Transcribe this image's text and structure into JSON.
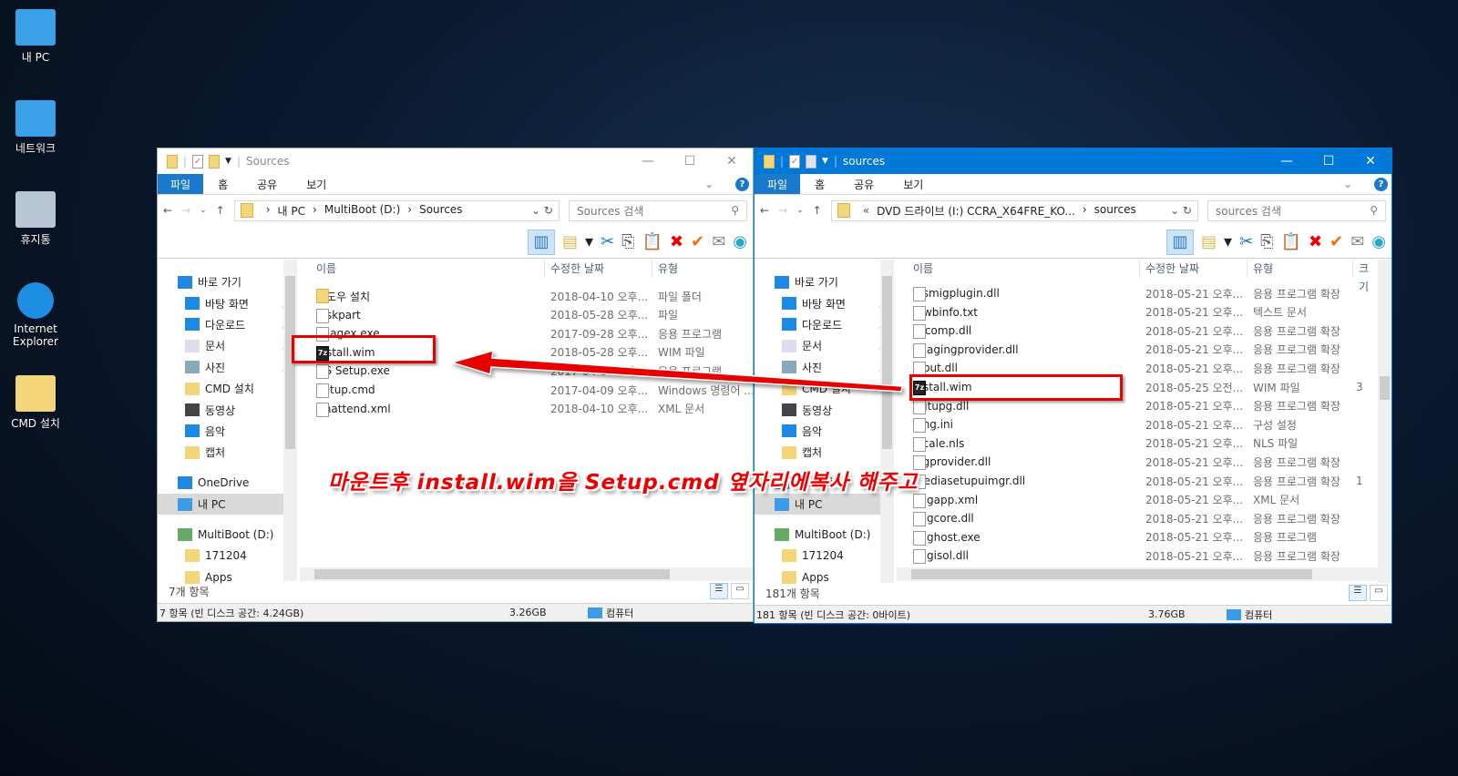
{
  "desktop": {
    "icons": [
      {
        "label": "내 PC",
        "icon": "computer-icon"
      },
      {
        "label": "네트워크",
        "icon": "network-icon"
      },
      {
        "label": "휴지통",
        "icon": "recycle-bin-icon"
      },
      {
        "label": "Internet Explorer",
        "icon": "internet-explorer-icon"
      },
      {
        "label": "CMD 설치",
        "icon": "folder-icon"
      }
    ]
  },
  "colors": {
    "accent": "#0078d7",
    "file_tab": "#1979ca",
    "highlight": "#e60000"
  },
  "ribbon_tabs": [
    "파일",
    "홈",
    "공유",
    "보기"
  ],
  "columns": [
    "이름",
    "수정한 날짜",
    "유형",
    "크기"
  ],
  "nav_items": [
    {
      "label": "바로 가기",
      "icon": "star-icon",
      "indent": 0
    },
    {
      "label": "바탕 화면",
      "icon": "desktop-icon",
      "indent": 1,
      "pinned": true
    },
    {
      "label": "다운로드",
      "icon": "download-icon",
      "indent": 1,
      "pinned": true
    },
    {
      "label": "문서",
      "icon": "document-icon",
      "indent": 1,
      "pinned": true
    },
    {
      "label": "사진",
      "icon": "pictures-icon",
      "indent": 1,
      "pinned": true
    },
    {
      "label": "CMD 설치",
      "icon": "folder-icon",
      "indent": 1
    },
    {
      "label": "동영상",
      "icon": "video-icon",
      "indent": 1
    },
    {
      "label": "음악",
      "icon": "music-icon",
      "indent": 1
    },
    {
      "label": "캡처",
      "icon": "folder-icon",
      "indent": 1
    },
    {
      "label": "",
      "icon": "",
      "indent": 0
    },
    {
      "label": "OneDrive",
      "icon": "onedrive-icon",
      "indent": 0
    },
    {
      "label": "내 PC",
      "icon": "computer-icon",
      "indent": 0,
      "selected": true
    },
    {
      "label": "",
      "icon": "",
      "indent": 0
    },
    {
      "label": "MultiBoot (D:)",
      "icon": "drive-icon",
      "indent": 0
    },
    {
      "label": "171204",
      "icon": "folder-icon",
      "indent": 1
    },
    {
      "label": "Apps",
      "icon": "folder-icon",
      "indent": 1
    }
  ],
  "left": {
    "title": "Sources",
    "breadcrumb": [
      "내 PC",
      "MultiBoot (D:)",
      "Sources"
    ],
    "search_placeholder": "Sources 검색",
    "files": [
      {
        "name": "윈도우 설치",
        "date": "2018-04-10 오후...",
        "type": "파일 폴더",
        "icon": "folder"
      },
      {
        "name": "diskpart",
        "date": "2018-05-28 오후...",
        "type": "파일",
        "icon": "file"
      },
      {
        "name": "Imagex.exe",
        "date": "2017-09-28 오후...",
        "type": "응용 프로그램",
        "icon": "exe"
      },
      {
        "name": "install.wim",
        "date": "2018-05-28 오후...",
        "type": "WIM 파일",
        "icon": "wim",
        "highlighted": true
      },
      {
        "name": "OS Setup.exe",
        "date": "2017-04-09 오후...",
        "type": "응용 프로그램",
        "icon": "exe"
      },
      {
        "name": "Setup.cmd",
        "date": "2017-04-09 오후...",
        "type": "Windows 명령어 ...",
        "icon": "cmd"
      },
      {
        "name": "Unattend.xml",
        "date": "2018-04-10 오후...",
        "type": "XML 문서",
        "icon": "xml"
      }
    ],
    "item_count": "7개 항목",
    "info": {
      "items": "7 항목 (빈 디스크 공간: 4.24GB)",
      "size": "3.26GB",
      "location": "컴퓨터"
    }
  },
  "right": {
    "title": "sources",
    "breadcrumb": [
      "DVD 드라이브 (I:) CCRA_X64FRE_KO...",
      "sources"
    ],
    "search_placeholder": "sources 검색",
    "files": [
      {
        "name": "iasmigplugin.dll",
        "date": "2018-05-21 오후...",
        "type": "응용 프로그램 확장",
        "icon": "dll"
      },
      {
        "name": "idwbinfo.txt",
        "date": "2018-05-21 오후...",
        "type": "텍스트 문서",
        "icon": "txt"
      },
      {
        "name": "iiscomp.dll",
        "date": "2018-05-21 오후...",
        "type": "응용 프로그램 확장",
        "icon": "dll"
      },
      {
        "name": "imagingprovider.dll",
        "date": "2018-05-21 오후...",
        "type": "응용 프로그램 확장",
        "icon": "dll"
      },
      {
        "name": "input.dll",
        "date": "2018-05-21 오후...",
        "type": "응용 프로그램 확장",
        "icon": "dll"
      },
      {
        "name": "install.wim",
        "date": "2018-05-25 오전...",
        "type": "WIM 파일",
        "icon": "wim",
        "highlighted": true,
        "size": "3"
      },
      {
        "name": "itgtupg.dll",
        "date": "2018-05-21 오후...",
        "type": "응용 프로그램 확장",
        "icon": "dll"
      },
      {
        "name": "lang.ini",
        "date": "2018-05-21 오후...",
        "type": "구성 설정",
        "icon": "ini"
      },
      {
        "name": "locale.nls",
        "date": "2018-05-21 오후...",
        "type": "NLS 파일",
        "icon": "file"
      },
      {
        "name": "logprovider.dll",
        "date": "2018-05-21 오후...",
        "type": "응용 프로그램 확장",
        "icon": "dll"
      },
      {
        "name": "mediasetupuimgr.dll",
        "date": "2018-05-21 오후...",
        "type": "응용 프로그램 확장",
        "icon": "dll",
        "size": "1"
      },
      {
        "name": "migapp.xml",
        "date": "2018-05-21 오후...",
        "type": "XML 문서",
        "icon": "xml"
      },
      {
        "name": "migcore.dll",
        "date": "2018-05-21 오후...",
        "type": "응용 프로그램 확장",
        "icon": "dll"
      },
      {
        "name": "mighost.exe",
        "date": "2018-05-21 오후...",
        "type": "응용 프로그램",
        "icon": "exe"
      },
      {
        "name": "migisol.dll",
        "date": "2018-05-21 오후...",
        "type": "응용 프로그램 확장",
        "icon": "dll"
      }
    ],
    "item_count": "181개 항목",
    "info": {
      "items": "181 항목 (빈 디스크 공간: 0바이트)",
      "size": "3.76GB",
      "location": "컴퓨터"
    }
  },
  "annotation": "마운트후 install.wim을 Setup.cmd 옆자리에복사 해주고"
}
